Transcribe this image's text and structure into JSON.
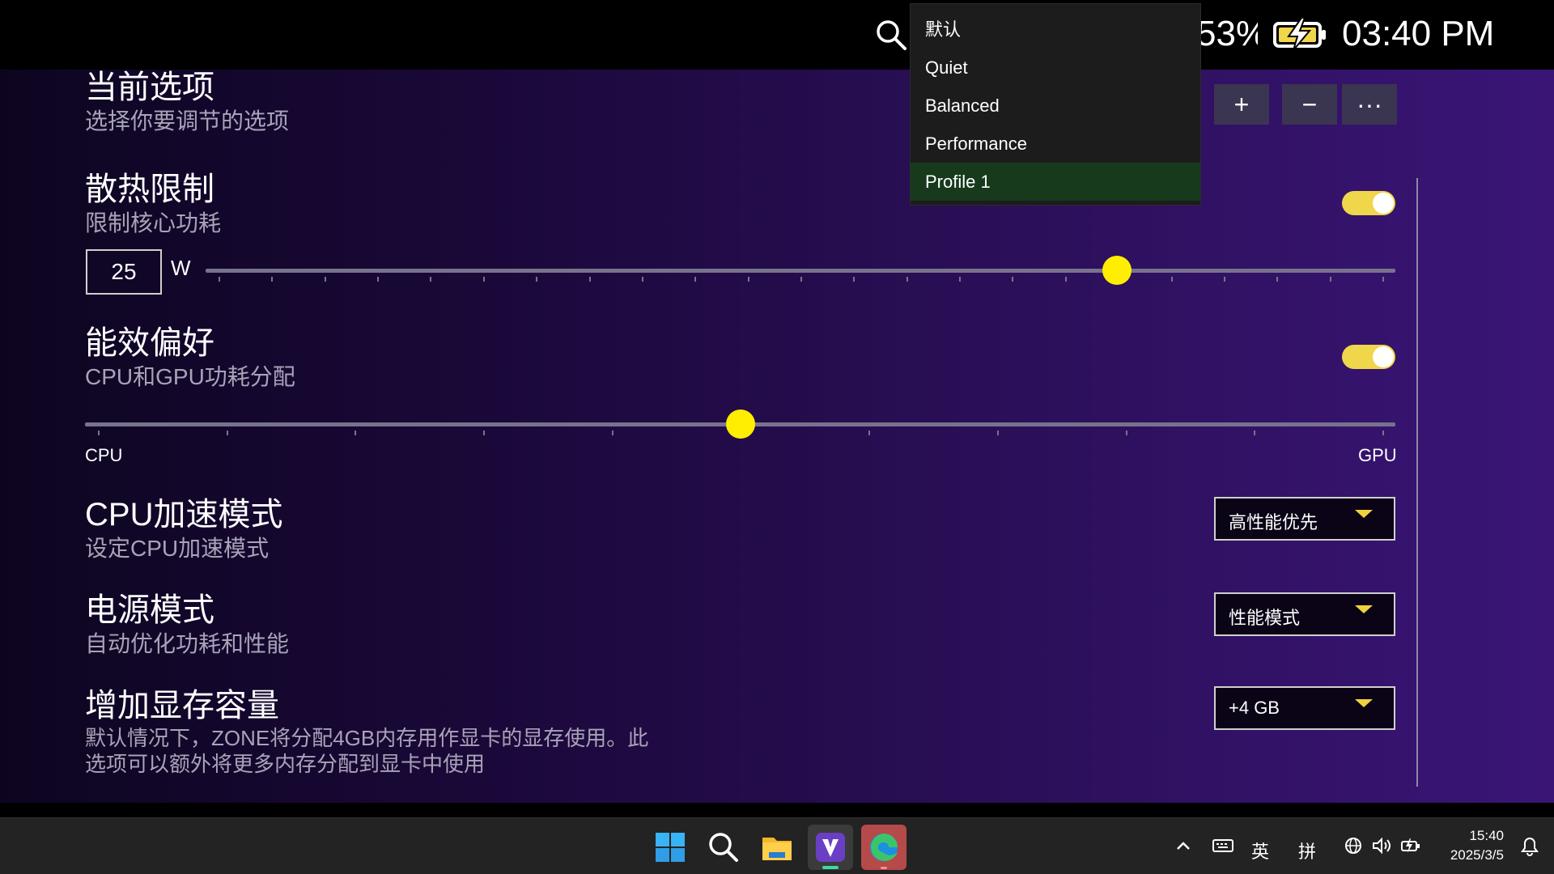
{
  "status_bar": {
    "battery_percent": "53%",
    "time": "03:40 PM",
    "icons": [
      "search-icon",
      "battery-charging-icon"
    ]
  },
  "profile_menu": {
    "items": [
      "默认",
      "Quiet",
      "Balanced",
      "Performance",
      "Profile 1"
    ],
    "selected": "Profile 1",
    "buttons": {
      "add": "+",
      "remove": "−",
      "more": "···"
    }
  },
  "current_option": {
    "title": "当前选项",
    "subtitle": "选择你要调节的选项"
  },
  "thermal_limit": {
    "title": "散热限制",
    "subtitle": "限制核心功耗",
    "enabled": true,
    "value": "25",
    "unit": "W",
    "slider_fraction": 0.766
  },
  "efficiency": {
    "title": "能效偏好",
    "subtitle": "CPU和GPU功耗分配",
    "enabled": true,
    "left_label": "CPU",
    "right_label": "GPU",
    "slider_fraction": 0.5
  },
  "cpu_boost": {
    "title": "CPU加速模式",
    "subtitle": "设定CPU加速模式",
    "value": "高性能优先"
  },
  "power_mode": {
    "title": "电源模式",
    "subtitle": "自动优化功耗和性能",
    "value": "性能模式"
  },
  "vram": {
    "title": "增加显存容量",
    "subtitle_line1": "默认情况下，ZONE将分配4GB内存用作显卡的显存使用。此",
    "subtitle_line2": "选项可以额外将更多内存分配到显卡中使用",
    "value": "+4 GB"
  },
  "taskbar": {
    "apps": [
      "windows-start-icon",
      "search-icon",
      "file-explorer-icon",
      "zone-app-icon",
      "edge-browser-icon"
    ],
    "tray": {
      "ime1": "英",
      "ime2": "拼"
    },
    "time": "15:40",
    "date": "2025/3/5"
  },
  "colors": {
    "accent": "#FFEE00",
    "toggle": "#F0D64A",
    "caret": "#F2D23C",
    "selected_item": "#173A1C"
  }
}
